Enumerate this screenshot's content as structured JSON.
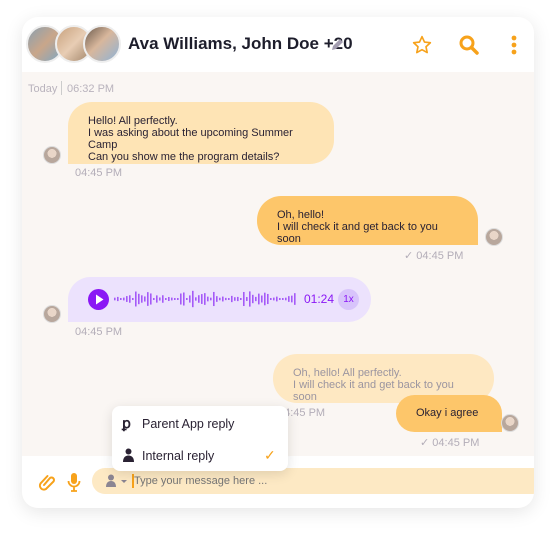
{
  "header": {
    "title": "Ava Williams, John Doe +20",
    "icons": [
      "avatar-group",
      "pencil-icon",
      "star-icon",
      "search-icon",
      "more-vertical-icon"
    ]
  },
  "date_divider": {
    "day": "Today",
    "time": "06:32 PM"
  },
  "messages": [
    {
      "side": "left",
      "lines": [
        "Hello! All perfectly.",
        "I was asking about the upcoming Summer Camp",
        "Can you show me the program details?"
      ],
      "time": "04:45 PM"
    },
    {
      "side": "right",
      "lines": [
        "Oh, hello!",
        "I will check it and get back to you soon"
      ],
      "time": "04:45 PM",
      "read": true
    },
    {
      "side": "left",
      "type": "audio",
      "duration": "01:24",
      "speed": "1x",
      "time": "04:45 PM"
    },
    {
      "side": "right",
      "lines": [
        "Oh, hello! All perfectly.",
        "I will check it and get back to you soon"
      ],
      "time": "04:45 PM",
      "faded": true
    },
    {
      "side": "right",
      "lines": [
        "Okay i agree"
      ],
      "time": "04:45 PM",
      "read": true
    }
  ],
  "reply_menu": {
    "items": [
      {
        "label": "Parent App reply",
        "icon": "parent-app-icon",
        "selected": false
      },
      {
        "label": "Internal reply",
        "icon": "person-icon",
        "selected": true
      }
    ]
  },
  "composer": {
    "placeholder": "Type your message here ..."
  },
  "colors": {
    "accent": "#f7a21b",
    "bubble_in": "#fee4b5",
    "bubble_out": "#fdc66a",
    "audio_bg": "#ece2fd",
    "audio_accent": "#8a17f5"
  }
}
